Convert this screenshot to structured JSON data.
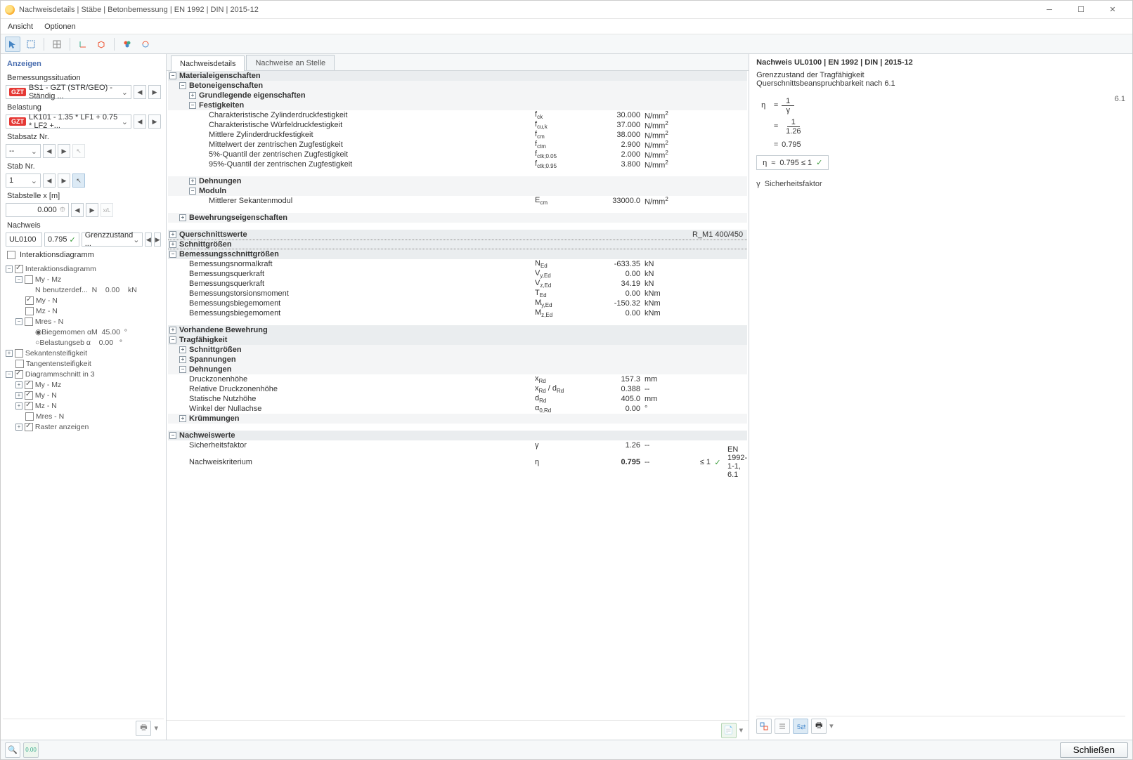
{
  "window": {
    "title": "Nachweisdetails | Stäbe | Betonbemessung | EN 1992 | DIN | 2015-12"
  },
  "menu": {
    "ansicht": "Ansicht",
    "optionen": "Optionen"
  },
  "left": {
    "title": "Anzeigen",
    "situation_label": "Bemessungssituation",
    "situation_badge": "GZT",
    "situation_text": "BS1 - GZT (STR/GEO) - Ständig ...",
    "load_label": "Belastung",
    "load_badge": "GZT",
    "load_text": "LK101 - 1.35 * LF1 + 0.75 * LF2 +...",
    "stabsatz_label": "Stabsatz Nr.",
    "stabsatz_val": "--",
    "stab_label": "Stab Nr.",
    "stab_val": "1",
    "stabstelle_label": "Stabstelle x [m]",
    "stabstelle_val": "0.000",
    "nachweis_label": "Nachweis",
    "nachweis_id": "UL0100",
    "nachweis_val": "0.795",
    "nachweis_text": "Grenzzustand ...",
    "interaktion": "Interaktionsdiagramm",
    "tree": {
      "root": "Interaktionsdiagramm",
      "mymz": "My - Mz",
      "nuser": "N benutzerdef...",
      "nuser_sym": "N",
      "nuser_val": "0.00",
      "nuser_unit": "kN",
      "myn": "My - N",
      "mzn": "Mz - N",
      "mresn": "Mres - N",
      "biege": "Biegemomen",
      "biege_sym": "αM",
      "biege_val": "45.00",
      "biege_unit": "°",
      "belast": "Belastungseb",
      "belast_sym": "α",
      "belast_val": "0.00",
      "belast_unit": "°",
      "sekant": "Sekantensteifigkeit",
      "tangent": "Tangentensteifigkeit",
      "diagschnitt": "Diagrammschnitt in 3",
      "d_mymz": "My - Mz",
      "d_myn": "My - N",
      "d_mzn": "Mz - N",
      "d_mresn": "Mres - N",
      "raster": "Raster anzeigen"
    }
  },
  "mid": {
    "tabs": {
      "details": "Nachweisdetails",
      "stelle": "Nachweise an Stelle"
    },
    "sections": {
      "material": "Materialeigenschaften",
      "beton": "Betoneigenschaften",
      "grund": "Grundlegende eigenschaften",
      "festig": "Festigkeiten",
      "dehn": "Dehnungen",
      "moduln": "Moduln",
      "bewehreig": "Bewehrungseigenschaften",
      "quers": "Querschnittswerte",
      "quers_val": "R_M1 400/450",
      "schnitt": "Schnittgrößen",
      "bemess": "Bemessungsschnittgrößen",
      "vorh": "Vorhandene Bewehrung",
      "trag": "Tragfähigkeit",
      "t_schnitt": "Schnittgrößen",
      "t_spann": "Spannungen",
      "t_dehn": "Dehnungen",
      "t_kruem": "Krümmungen",
      "nwwerte": "Nachweiswerte"
    },
    "rows": {
      "fck": {
        "n": "Charakteristische Zylinderdruckfestigkeit",
        "s": "f",
        "sub": "ck",
        "v": "30.000",
        "u": "N/mm",
        "sup": "2"
      },
      "fcuk": {
        "n": "Charakteristische Würfeldruckfestigkeit",
        "s": "f",
        "sub": "cu,k",
        "v": "37.000",
        "u": "N/mm",
        "sup": "2"
      },
      "fcm": {
        "n": "Mittlere Zylinderdruckfestigkeit",
        "s": "f",
        "sub": "cm",
        "v": "38.000",
        "u": "N/mm",
        "sup": "2"
      },
      "fctm": {
        "n": "Mittelwert der zentrischen Zugfestigkeit",
        "s": "f",
        "sub": "ctm",
        "v": "2.900",
        "u": "N/mm",
        "sup": "2"
      },
      "fctk005": {
        "n": "5%-Quantil der zentrischen Zugfestigkeit",
        "s": "f",
        "sub": "ctk;0.05",
        "v": "2.000",
        "u": "N/mm",
        "sup": "2"
      },
      "fctk095": {
        "n": "95%-Quantil der zentrischen Zugfestigkeit",
        "s": "f",
        "sub": "ctk;0.95",
        "v": "3.800",
        "u": "N/mm",
        "sup": "2"
      },
      "ecm": {
        "n": "Mittlerer Sekantenmodul",
        "s": "E",
        "sub": "cm",
        "v": "33000.0",
        "u": "N/mm",
        "sup": "2"
      },
      "ned": {
        "n": "Bemessungsnormalkraft",
        "s": "N",
        "sub": "Ed",
        "v": "-633.35",
        "u": "kN"
      },
      "vyed": {
        "n": "Bemessungsquerkraft",
        "s": "V",
        "sub": "y,Ed",
        "v": "0.00",
        "u": "kN"
      },
      "vzed": {
        "n": "Bemessungsquerkraft",
        "s": "V",
        "sub": "z,Ed",
        "v": "34.19",
        "u": "kN"
      },
      "ted": {
        "n": "Bemessungstorsionsmoment",
        "s": "T",
        "sub": "Ed",
        "v": "0.00",
        "u": "kNm"
      },
      "myed": {
        "n": "Bemessungsbiegemoment",
        "s": "M",
        "sub": "y,Ed",
        "v": "-150.32",
        "u": "kNm"
      },
      "mzed": {
        "n": "Bemessungsbiegemoment",
        "s": "M",
        "sub": "z,Ed",
        "v": "0.00",
        "u": "kNm"
      },
      "xrd": {
        "n": "Druckzonenhöhe",
        "s": "x",
        "sub": "Rd",
        "v": "157.3",
        "u": "mm"
      },
      "xrddrd": {
        "n": "Relative Druckzonenhöhe",
        "s": "x",
        "sub": "Rd",
        "s2": " / d",
        "sub2": "Rd",
        "v": "0.388",
        "u": "--"
      },
      "drd": {
        "n": "Statische Nutzhöhe",
        "s": "d",
        "sub": "Rd",
        "v": "405.0",
        "u": "mm"
      },
      "a0": {
        "n": "Winkel der Nullachse",
        "s": "α",
        "sub": "0,Rd",
        "v": "0.00",
        "u": "°"
      },
      "gamma": {
        "n": "Sicherheitsfaktor",
        "s": "γ",
        "v": "1.26",
        "u": "--"
      },
      "eta": {
        "n": "Nachweiskriterium",
        "s": "η",
        "v": "0.795",
        "u": "--",
        "cmp": "≤ 1",
        "ref": "EN 1992-1-1, 6.1"
      }
    }
  },
  "right": {
    "title": "Nachweis UL0100 | EN 1992 | DIN | 2015-12",
    "d1": "Grenzzustand der Tragfähigkeit",
    "d2": "Querschnittsbeanspruchbarkeit nach 6.1",
    "eta": "η",
    "eq": "=",
    "one": "1",
    "gamma": "γ",
    "g_val": "1.26",
    "res": "0.795",
    "approx": "≈",
    "boxed": "0.795  ≤ 1",
    "ref": "6.1",
    "legend_sym": "γ",
    "legend_txt": "Sicherheitsfaktor"
  },
  "footer": {
    "close": "Schließen"
  }
}
